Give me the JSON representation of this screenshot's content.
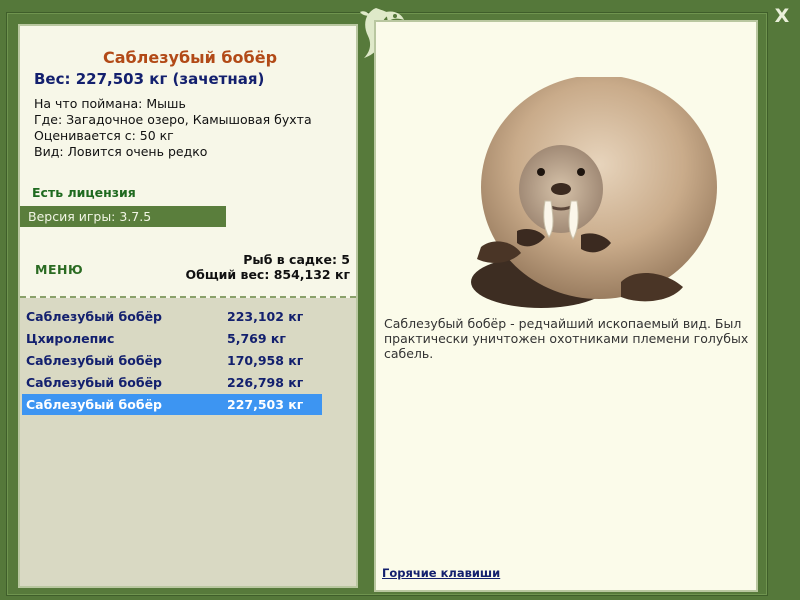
{
  "window": {
    "close_label": "X"
  },
  "fish": {
    "title": "Саблезубый бобёр",
    "weight_line": "Вес: 227,503 кг (зачетная)",
    "caught_on": "На что поймана: Мышь",
    "location": "Где: Загадочное озеро, Камышовая бухта",
    "rated_from": "Оценивается с: 50 кг",
    "species_note": "Вид: Ловится очень редко"
  },
  "license": {
    "label": "Есть лицензия"
  },
  "game": {
    "version": "Версия игры: 3.7.5"
  },
  "menu": {
    "label": "МЕНЮ"
  },
  "catch": {
    "count": "Рыб в садке: 5",
    "total_weight": "Общий вес: 854,132 кг"
  },
  "catch_list": [
    {
      "name": "Саблезубый бобёр",
      "weight": "223,102 кг",
      "selected": false
    },
    {
      "name": "Цхиролепис",
      "weight": "5,769 кг",
      "selected": false
    },
    {
      "name": "Саблезубый бобёр",
      "weight": "170,958 кг",
      "selected": false
    },
    {
      "name": "Саблезубый бобёр",
      "weight": "226,798 кг",
      "selected": false
    },
    {
      "name": "Саблезубый бобёр",
      "weight": "227,503 кг",
      "selected": true
    }
  ],
  "description": "Саблезубый бобёр - редчайший ископаемый вид. Был практически уничтожен охотниками племени голубых сабель.",
  "footer": {
    "hotkeys_link": "Горячие клавиши"
  },
  "colors": {
    "frame_green": "#55783a",
    "selected_row": "#3d95f2",
    "title_orange": "#b24a17",
    "text_navy": "#13206e"
  }
}
